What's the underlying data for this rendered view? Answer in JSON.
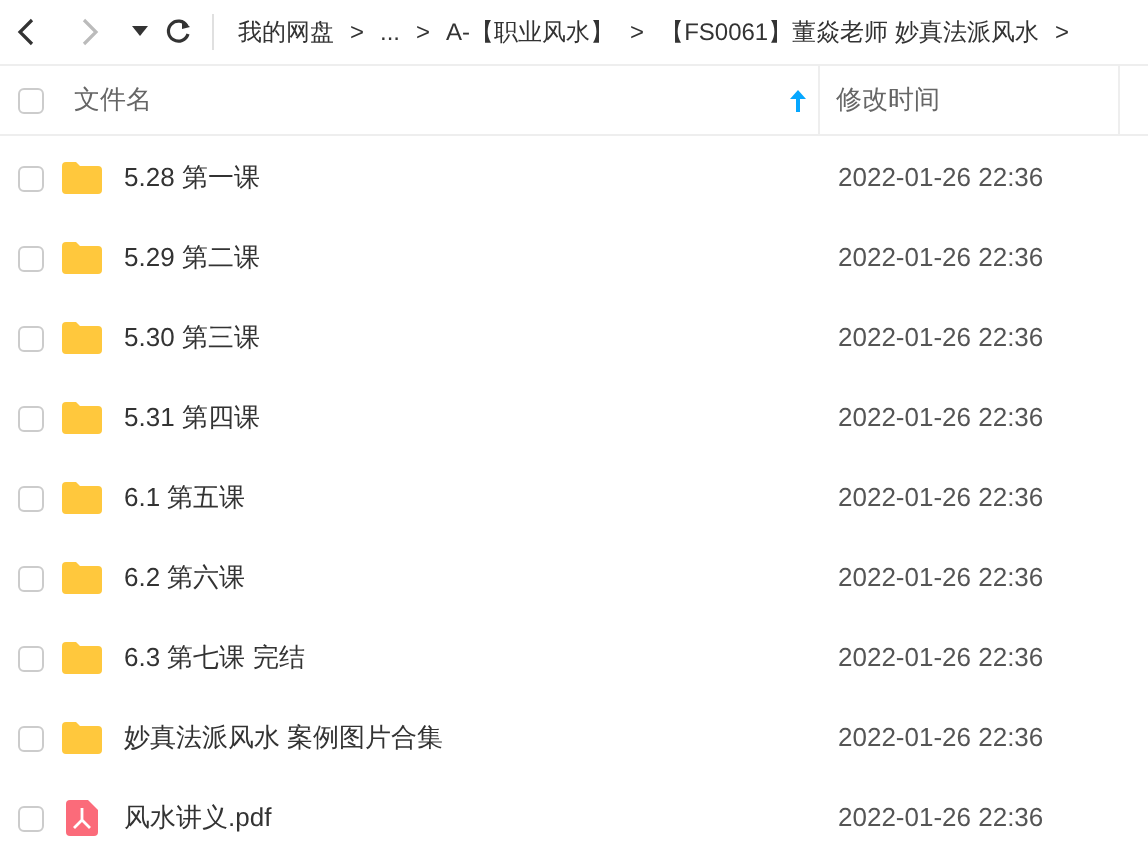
{
  "toolbar": {
    "breadcrumbs": [
      "我的网盘",
      "...",
      "A-【职业风水】",
      "【FS0061】董焱老师 妙真法派风水"
    ],
    "separator": ">"
  },
  "table": {
    "select_all": {
      "checked": false
    },
    "columns": [
      {
        "label": "文件名",
        "sorted": true
      },
      {
        "label": "修改时间",
        "sorted": false
      }
    ],
    "rows": [
      {
        "kind": "folder",
        "name": "5.28 第一课",
        "modified": "2022-01-26 22:36",
        "checked": false
      },
      {
        "kind": "folder",
        "name": "5.29 第二课",
        "modified": "2022-01-26 22:36",
        "checked": false
      },
      {
        "kind": "folder",
        "name": "5.30 第三课",
        "modified": "2022-01-26 22:36",
        "checked": false
      },
      {
        "kind": "folder",
        "name": "5.31 第四课",
        "modified": "2022-01-26 22:36",
        "checked": false
      },
      {
        "kind": "folder",
        "name": "6.1 第五课",
        "modified": "2022-01-26 22:36",
        "checked": false
      },
      {
        "kind": "folder",
        "name": "6.2 第六课",
        "modified": "2022-01-26 22:36",
        "checked": false
      },
      {
        "kind": "folder",
        "name": "6.3 第七课 完结",
        "modified": "2022-01-26 22:36",
        "checked": false
      },
      {
        "kind": "folder",
        "name": "妙真法派风水 案例图片合集",
        "modified": "2022-01-26 22:36",
        "checked": false
      },
      {
        "kind": "pdf",
        "name": "风水讲义.pdf",
        "modified": "2022-01-26 22:36",
        "checked": false
      }
    ]
  }
}
